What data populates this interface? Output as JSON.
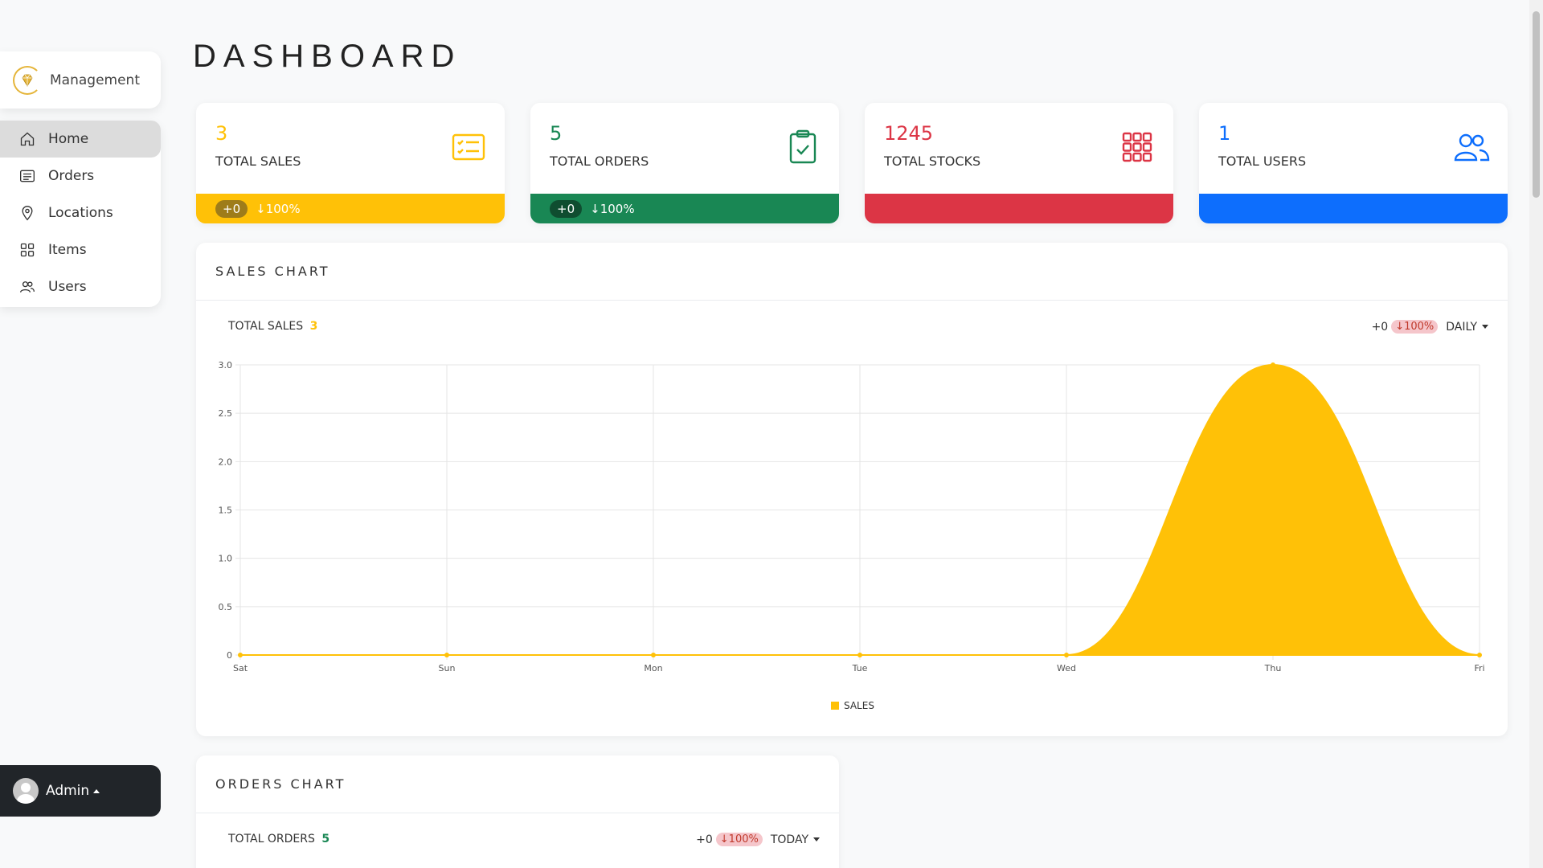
{
  "brand": {
    "name": "Management"
  },
  "nav": [
    {
      "label": "Home",
      "icon": "home-icon"
    },
    {
      "label": "Orders",
      "icon": "list-icon"
    },
    {
      "label": "Locations",
      "icon": "map-pin-icon"
    },
    {
      "label": "Items",
      "icon": "grid-icon"
    },
    {
      "label": "Users",
      "icon": "users-icon"
    }
  ],
  "user": {
    "name": "Admin"
  },
  "page": {
    "title": "DASHBOARD"
  },
  "cards": [
    {
      "value": "3",
      "label": "TOTAL SALES",
      "color": "#ffc107",
      "delta": "+0",
      "pct": "↓100%",
      "icon": "checklist-icon"
    },
    {
      "value": "5",
      "label": "TOTAL ORDERS",
      "color": "#198754",
      "delta": "+0",
      "pct": "↓100%",
      "icon": "clipboard-check-icon"
    },
    {
      "value": "1245",
      "label": "TOTAL STOCKS",
      "color": "#dc3545",
      "icon": "grid-icon"
    },
    {
      "value": "1",
      "label": "TOTAL USERS",
      "color": "#0d6efd",
      "icon": "users-icon"
    }
  ],
  "sales_chart": {
    "title": "SALES CHART",
    "total_label": "TOTAL SALES",
    "total_value": "3",
    "delta": "+0",
    "pct": "↓100%",
    "period": "DAILY"
  },
  "orders_chart": {
    "title": "ORDERS CHART",
    "total_label": "TOTAL ORDERS",
    "total_value": "5",
    "delta": "+0",
    "pct": "↓100%",
    "period": "TODAY"
  },
  "chart_data": {
    "type": "area",
    "categories": [
      "Sat",
      "Sun",
      "Mon",
      "Tue",
      "Wed",
      "Thu",
      "Fri"
    ],
    "series": [
      {
        "name": "SALES",
        "values": [
          0,
          0,
          0,
          0,
          0,
          3,
          0
        ],
        "color": "#ffc107"
      }
    ],
    "ylim": [
      0,
      3
    ],
    "yticks": [
      "0",
      "0.5",
      "1.0",
      "1.5",
      "2.0",
      "2.5",
      "3.0"
    ],
    "grid": true,
    "legend": "bottom-center"
  }
}
